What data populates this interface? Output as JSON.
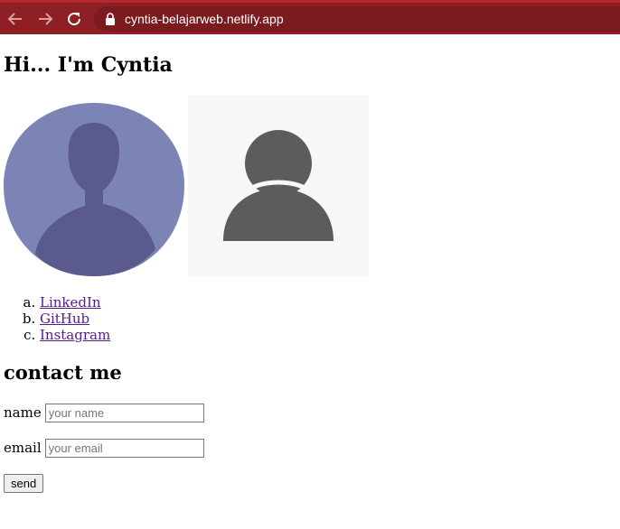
{
  "browser": {
    "url": "cyntia-belajarweb.netlify.app",
    "theme_color": "#8e1f24",
    "icons": {
      "back": "arrow-left-icon",
      "forward": "arrow-right-icon",
      "reload": "reload-icon",
      "secure": "lock-icon"
    }
  },
  "page": {
    "title": "Hi... I'm Cyntia",
    "images": [
      {
        "kind": "avatar-silhouette-blob",
        "color": "#7b84b5"
      },
      {
        "kind": "default-user-avatar",
        "color": "#5b5d5c"
      }
    ],
    "links": [
      {
        "label": "LinkedIn"
      },
      {
        "label": "GitHub"
      },
      {
        "label": "Instagram"
      }
    ],
    "link_color": "#551a8b",
    "contact_heading": "contact me",
    "form": {
      "name_label": "name",
      "name_placeholder": "your name",
      "email_label": "email",
      "email_placeholder": "your email",
      "send_label": "send"
    }
  }
}
